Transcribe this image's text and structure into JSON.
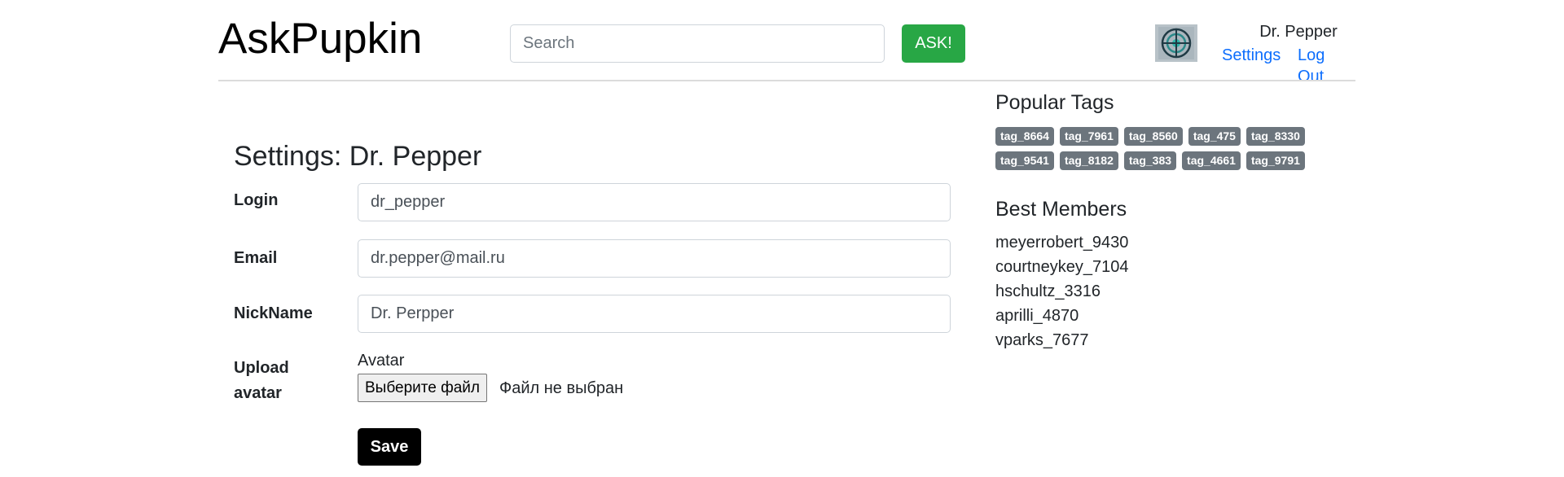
{
  "header": {
    "logo": "AskPupkin",
    "search_placeholder": "Search",
    "ask_label": "ASK!",
    "username": "Dr. Pepper",
    "settings_link": "Settings",
    "logout_link": "Log Out"
  },
  "settings": {
    "title": "Settings: Dr. Pepper",
    "login_label": "Login",
    "login_value": "dr_pepper",
    "email_label": "Email",
    "email_value": "dr.pepper@mail.ru",
    "nickname_label": "NickName",
    "nickname_value": "Dr. Perpper",
    "upload_label_line1": "Upload",
    "upload_label_line2": "avatar",
    "avatar_caption": "Avatar",
    "file_button": "Выберите файл",
    "file_status": "Файл не выбран",
    "save_label": "Save"
  },
  "sidebar": {
    "tags_title": "Popular Tags",
    "tags": [
      "tag_8664",
      "tag_7961",
      "tag_8560",
      "tag_475",
      "tag_8330",
      "tag_9541",
      "tag_8182",
      "tag_383",
      "tag_4661",
      "tag_9791"
    ],
    "members_title": "Best Members",
    "members": [
      "meyerrobert_9430",
      "courtneykey_7104",
      "hschultz_3316",
      "aprilli_4870",
      "vparks_7677"
    ]
  },
  "colors": {
    "ask_button": "#28a745",
    "link": "#0d6efd",
    "tag_badge": "#6c757d",
    "save_button": "#000000"
  }
}
